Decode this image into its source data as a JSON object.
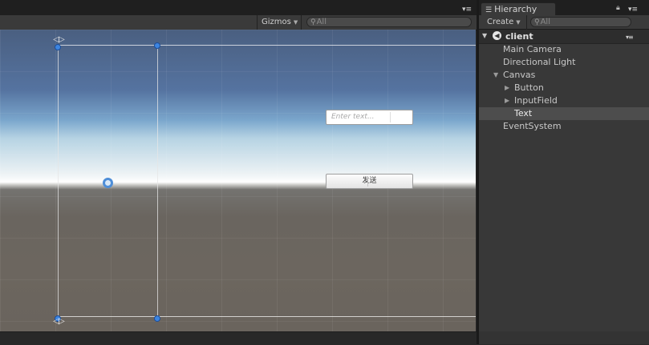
{
  "scene_view": {
    "toolbar": {
      "gizmos_label": "Gizmos",
      "search_placeholder": "All"
    },
    "ui_preview": {
      "input_placeholder": "Enter text...",
      "button_label": "发送"
    }
  },
  "hierarchy": {
    "tab_label": "Hierarchy",
    "create_label": "Create",
    "search_placeholder": "All",
    "scene_name": "client",
    "items": [
      {
        "label": "Main Camera",
        "depth": 0,
        "arrow": "",
        "selected": false
      },
      {
        "label": "Directional Light",
        "depth": 0,
        "arrow": "",
        "selected": false
      },
      {
        "label": "Canvas",
        "depth": 0,
        "arrow": "▼",
        "selected": false
      },
      {
        "label": "Button",
        "depth": 1,
        "arrow": "▶",
        "selected": false
      },
      {
        "label": "InputField",
        "depth": 1,
        "arrow": "▶",
        "selected": false
      },
      {
        "label": "Text",
        "depth": 1,
        "arrow": "",
        "selected": true
      },
      {
        "label": "EventSystem",
        "depth": 0,
        "arrow": "",
        "selected": false
      }
    ]
  },
  "colors": {
    "handle": "#3d85e0",
    "selection": "#4d4d4d",
    "panel": "#383838"
  }
}
